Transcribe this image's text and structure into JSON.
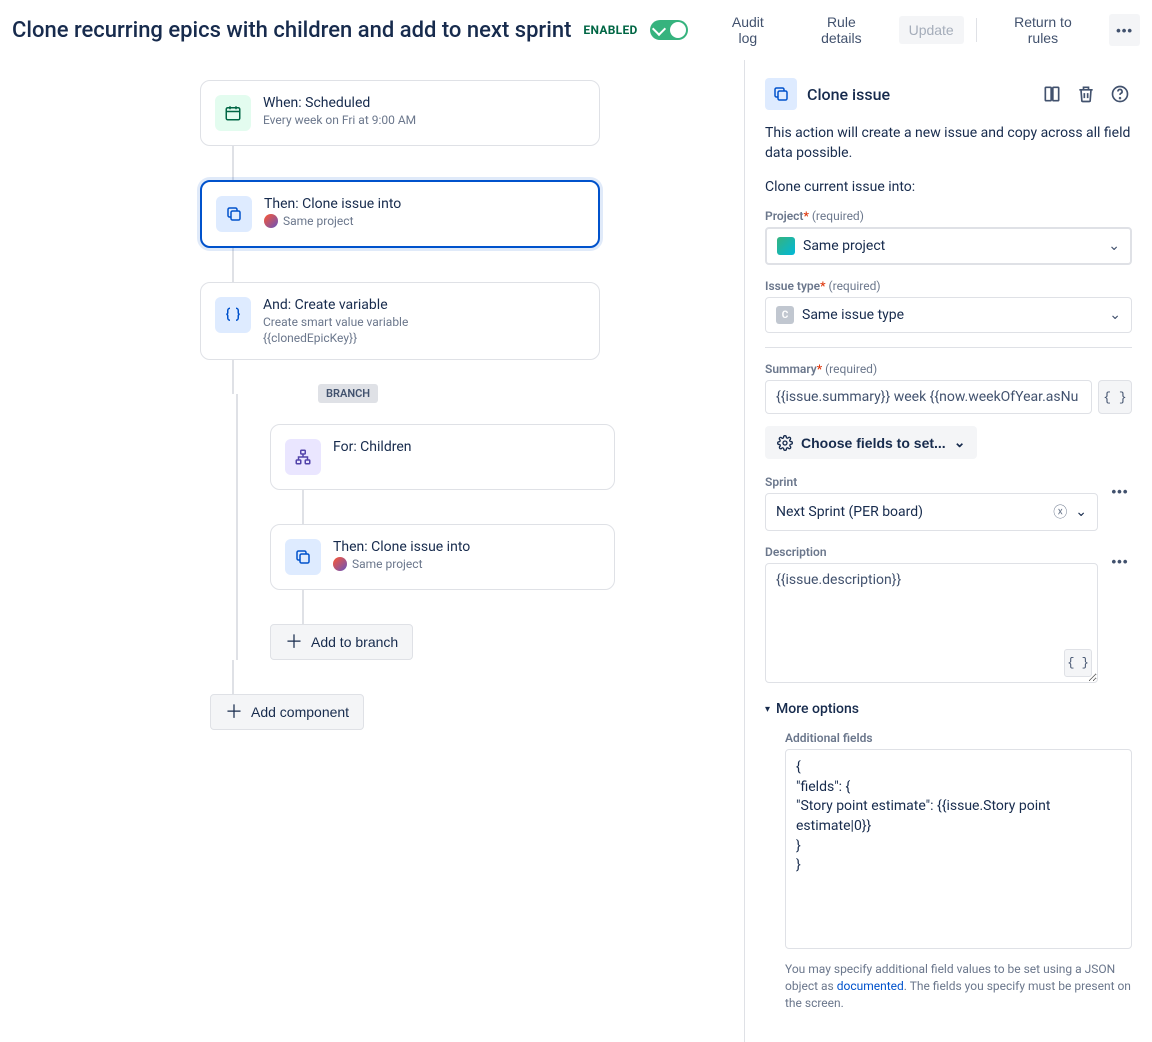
{
  "header": {
    "title": "Clone recurring epics with children and add to next sprint",
    "enabled_label": "ENABLED",
    "audit_log": "Audit log",
    "rule_details": "Rule details",
    "update": "Update",
    "return": "Return to rules"
  },
  "flow": {
    "trigger": {
      "title": "When: Scheduled",
      "sub": "Every week on Fri at 9:00 AM"
    },
    "action1": {
      "title": "Then: Clone issue into",
      "sub": "Same project"
    },
    "action2": {
      "title": "And: Create variable",
      "sub": "Create smart value variable",
      "sub2": "{{clonedEpicKey}}"
    },
    "branch_label": "BRANCH",
    "branch_for": {
      "title": "For: Children"
    },
    "branch_action": {
      "title": "Then: Clone issue into",
      "sub": "Same project"
    },
    "add_branch": "Add to branch",
    "add_component": "Add component"
  },
  "panel": {
    "title": "Clone issue",
    "desc": "This action will create a new issue and copy across all field data possible.",
    "subhead": "Clone current issue into:",
    "project_label": "Project",
    "required": "(required)",
    "project_value": "Same project",
    "issuetype_label": "Issue type",
    "issuetype_value": "Same issue type",
    "summary_label": "Summary",
    "summary_value": "{{issue.summary}} week {{now.weekOfYear.asNu",
    "choose_fields": "Choose fields to set...",
    "sprint_label": "Sprint",
    "sprint_value": "Next Sprint (PER board)",
    "description_label": "Description",
    "description_value": "{{issue.description}}",
    "more_options": "More options",
    "additional_label": "Additional fields",
    "additional_value": "{\n\"fields\": {\n\"Story point estimate\": {{issue.Story point estimate|0}}\n}\n}",
    "helper1": "You may specify additional field values to be set using a JSON object as ",
    "helper_link": "documented",
    "helper2": ". The fields you specify must be present on the screen."
  }
}
